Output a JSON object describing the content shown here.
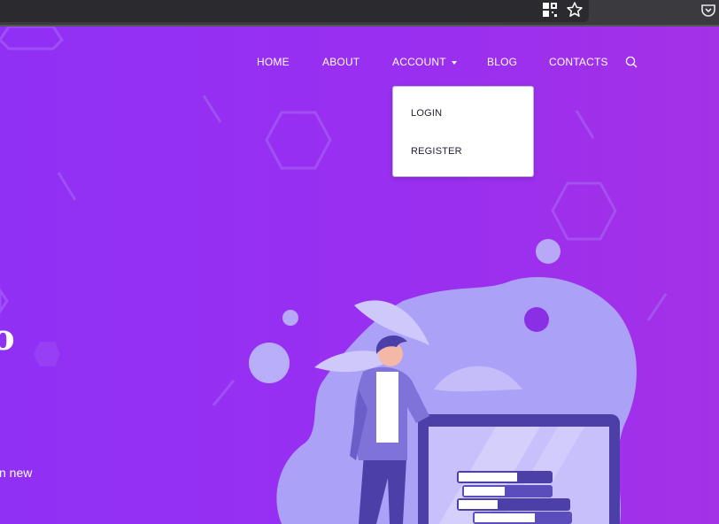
{
  "browser": {
    "icons": [
      "qr-grid-icon",
      "star-icon",
      "pocket-icon"
    ]
  },
  "nav": {
    "items": [
      {
        "label": "HOME"
      },
      {
        "label": "ABOUT"
      },
      {
        "label": "ACCOUNT"
      },
      {
        "label": "BLOG"
      },
      {
        "label": "CONTACTS"
      }
    ],
    "search_icon": "search-icon"
  },
  "dropdown": {
    "items": [
      {
        "label": "LOGIN"
      },
      {
        "label": "REGISTER"
      }
    ]
  },
  "hero": {
    "title_fragment": "o",
    "subtitle_fragment": "n new"
  },
  "colors": {
    "hero_start": "#9030f5",
    "hero_end": "#a331e6",
    "illustration_blob": "#aaa2f7",
    "screen_frame": "#4d3fa8"
  }
}
